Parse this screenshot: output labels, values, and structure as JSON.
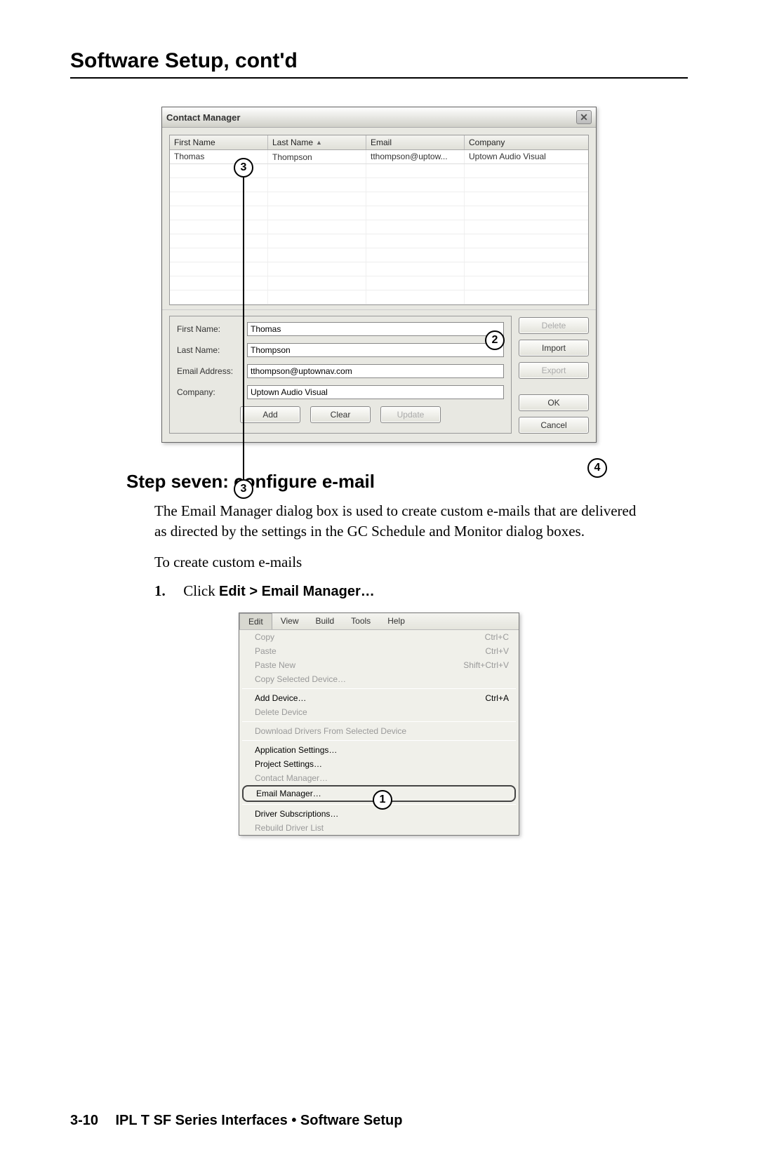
{
  "header": "Software Setup, cont'd",
  "dialog": {
    "title": "Contact Manager",
    "columns": {
      "first": "First Name",
      "last": "Last Name",
      "email": "Email",
      "company": "Company"
    },
    "row": {
      "first": "Thomas",
      "last": "Thompson",
      "email": "tthompson@uptow...",
      "company": "Uptown Audio Visual"
    },
    "form": {
      "lbl_first": "First Name:",
      "val_first": "Thomas",
      "lbl_last": "Last Name:",
      "val_last": "Thompson",
      "lbl_email": "Email Address:",
      "val_email": "tthompson@uptownav.com",
      "lbl_company": "Company:",
      "val_company": "Uptown Audio Visual",
      "btn_add": "Add",
      "btn_clear": "Clear",
      "btn_update": "Update"
    },
    "side": {
      "delete": "Delete",
      "import": "Import",
      "export": "Export",
      "ok": "OK",
      "cancel": "Cancel"
    },
    "callouts": {
      "c2": "2",
      "c3a": "3",
      "c3b": "3",
      "c4": "4"
    }
  },
  "step": {
    "title": "Step seven: configure e-mail",
    "para1": "The Email Manager dialog box is used to create custom e-mails that are delivered as directed by the settings in the GC Schedule and Monitor dialog boxes.",
    "para2": "To create custom e-mails",
    "s1num": "1.",
    "s1a": "Click ",
    "s1b": "Edit > Email Manager…"
  },
  "menu": {
    "bar": {
      "edit": "Edit",
      "view": "View",
      "build": "Build",
      "tools": "Tools",
      "help": "Help"
    },
    "items": {
      "copy": "Copy",
      "copy_sc": "Ctrl+C",
      "paste": "Paste",
      "paste_sc": "Ctrl+V",
      "paste_new": "Paste New",
      "paste_new_sc": "Shift+Ctrl+V",
      "copy_sel": "Copy Selected Device…",
      "add_dev": "Add Device…",
      "add_dev_sc": "Ctrl+A",
      "del_dev": "Delete Device",
      "dl_drv": "Download Drivers From Selected Device",
      "app_set": "Application Settings…",
      "proj_set": "Project Settings…",
      "contact_mgr": "Contact Manager…",
      "email_mgr": "Email Manager…",
      "drv_sub": "Driver Subscriptions…",
      "rebuild": "Rebuild Driver List"
    },
    "callout1": "1"
  },
  "footer": {
    "page": "3-10",
    "text": "IPL T SF Series Interfaces • Software Setup"
  }
}
